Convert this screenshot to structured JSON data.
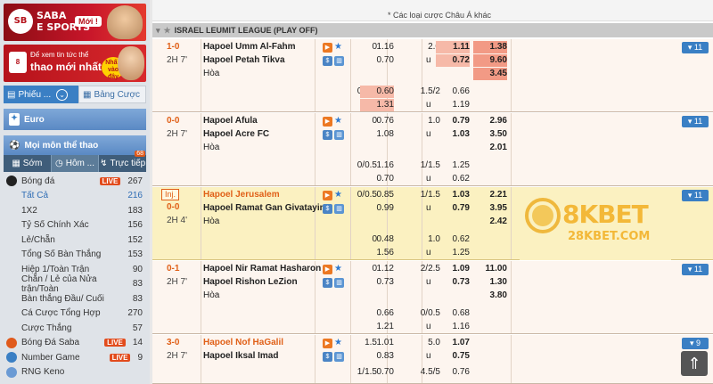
{
  "sidebar": {
    "saba_banner": {
      "logo": "SB",
      "line1": "SABA",
      "line2": "E SPORTS",
      "badge": "Mới !"
    },
    "news_banner": {
      "logo": "8",
      "small": "Để xem tin tức thể",
      "big": "thao mới nhất",
      "badge": "Nhấn vào đây"
    },
    "tab_phieu": "Phiếu ...",
    "tab_bang": "Bảng Cược",
    "euro": "Euro",
    "all_sports": "Mọi môn thể thao",
    "time_tabs": [
      {
        "label": "Sớm"
      },
      {
        "label": "Hôm ..."
      },
      {
        "label": "Trực tiếp",
        "count": "68"
      }
    ],
    "sports": [
      {
        "label": "Bóng đá",
        "live": "LIVE",
        "count": "267",
        "top": true,
        "color": "#222"
      },
      {
        "label": "Tất Cả",
        "count": "216",
        "selected": true
      },
      {
        "label": "1X2",
        "count": "183"
      },
      {
        "label": "Tỷ Số Chính Xác",
        "count": "156"
      },
      {
        "label": "Lẻ/Chẵn",
        "count": "152"
      },
      {
        "label": "Tổng Số Bàn Thắng",
        "count": "153"
      },
      {
        "label": "Hiệp 1/Toàn Trận",
        "count": "90"
      },
      {
        "label": "Chẵn / Lẻ của Nửa trận/Toàn",
        "count": "83"
      },
      {
        "label": "Bàn thắng Đầu/ Cuối",
        "count": "83"
      },
      {
        "label": "Cá Cược Tổng Hợp",
        "count": "270"
      },
      {
        "label": "Cược Thắng",
        "count": "57"
      },
      {
        "label": "Bóng Đá Saba",
        "live": "LIVE",
        "count": "14",
        "top": true,
        "color": "#e05a1c"
      },
      {
        "label": "Number Game",
        "live": "LIVE",
        "count": "9",
        "top": true,
        "color": "#3a7fc4"
      },
      {
        "label": "RNG Keno",
        "count": "",
        "top": true,
        "color": "#6a9ad4"
      }
    ]
  },
  "main": {
    "filter_text": "* Các loại cược Châu Á khác",
    "league": "ISRAEL LEUMIT LEAGUE (PLAY OFF)",
    "matches": [
      {
        "score": "1-0",
        "time": "2H 7'",
        "home": "Hapoel Umm Al-Fahm",
        "away": "Hapoel Petah Tikva",
        "draw": "Hòa",
        "home_fav": false,
        "more": "▾ 11",
        "rows": [
          {
            "h1": "0",
            "o1": "1.16",
            "o2": "0.70",
            "h2": "2.0",
            "o3": "1.11",
            "o4": "0.72",
            "x1": "1.38",
            "x2": "9.60",
            "x3": "3.45"
          },
          {
            "h1": "0/0.5",
            "o1": "0.60",
            "o2": "1.31",
            "h2": "1.5/2",
            "o3": "0.66",
            "o4": "1.19"
          }
        ]
      },
      {
        "score": "0-0",
        "time": "2H 7'",
        "home": "Hapoel Afula",
        "away": "Hapoel Acre FC",
        "draw": "Hòa",
        "home_fav": false,
        "more": "▾ 11",
        "rows": [
          {
            "h1": "0",
            "o1": "0.76",
            "o2": "1.08",
            "h2": "1.0",
            "o3": "0.79",
            "o4": "1.03",
            "x1": "2.96",
            "x2": "3.50",
            "x3": "2.01"
          },
          {
            "h1": "0/0.5",
            "o1": "1.16",
            "o2": "0.70",
            "h2": "1/1.5",
            "o3": "1.25",
            "o4": "0.62"
          }
        ]
      },
      {
        "inj": "Inj.",
        "score": "0-0",
        "time": "2H 4'",
        "home": "Hapoel Jerusalem",
        "away": "Hapoel Ramat Gan Givatayim",
        "draw": "Hòa",
        "home_fav": true,
        "more": "▾ 11",
        "rows": [
          {
            "h1": "0/0.5",
            "o1": "0.85",
            "o2": "0.99",
            "h2": "1/1.5",
            "o3": "1.03",
            "o4": "0.79",
            "x1": "2.21",
            "x2": "3.95",
            "x3": "2.42"
          },
          {
            "h1": "0",
            "o1": "0.48",
            "o2": "1.56",
            "h2": "1.0",
            "o3": "0.62",
            "o4": "1.25"
          }
        ]
      },
      {
        "score": "0-1",
        "time": "2H 7'",
        "home": "Hapoel Nir Ramat Hasharon",
        "away": "Hapoel Rishon LeZion",
        "draw": "Hòa",
        "home_fav": false,
        "more": "▾ 11",
        "rows": [
          {
            "h1": "0",
            "o1": "1.12",
            "o2": "0.73",
            "h2": "2/2.5",
            "o3": "1.09",
            "o4": "0.73",
            "x1": "11.00",
            "x2": "1.30",
            "x3": "3.80"
          },
          {
            "h1": "",
            "o1": "0.66",
            "o2": "1.21",
            "h2": "0/0.5",
            "o3": "0.68",
            "o4": "1.16"
          }
        ]
      },
      {
        "score": "3-0",
        "time": "2H 7'",
        "home": "Hapoel Nof HaGalil",
        "away": "Hapoel Iksal Imad",
        "draw": "",
        "home_fav": true,
        "more": "▾ 9",
        "rows": [
          {
            "h1": "1.5",
            "o1": "1.01",
            "o2": "0.83",
            "h2": "5.0",
            "o3": "1.07",
            "o4": "0.75",
            "x1": "",
            "x2": "",
            "x3": ""
          },
          {
            "h1": "1/1.5",
            "o1": "0.70",
            "o2": "",
            "h2": "4.5/5",
            "o3": "0.76",
            "o4": ""
          }
        ]
      }
    ],
    "ad": {
      "title": "8KBET",
      "sub": "28KBET.COM"
    }
  },
  "scroll_top": "⇑",
  "colors": {
    "accent": "#3a7fc4",
    "live": "#e24b1c",
    "score": "#e06018"
  }
}
